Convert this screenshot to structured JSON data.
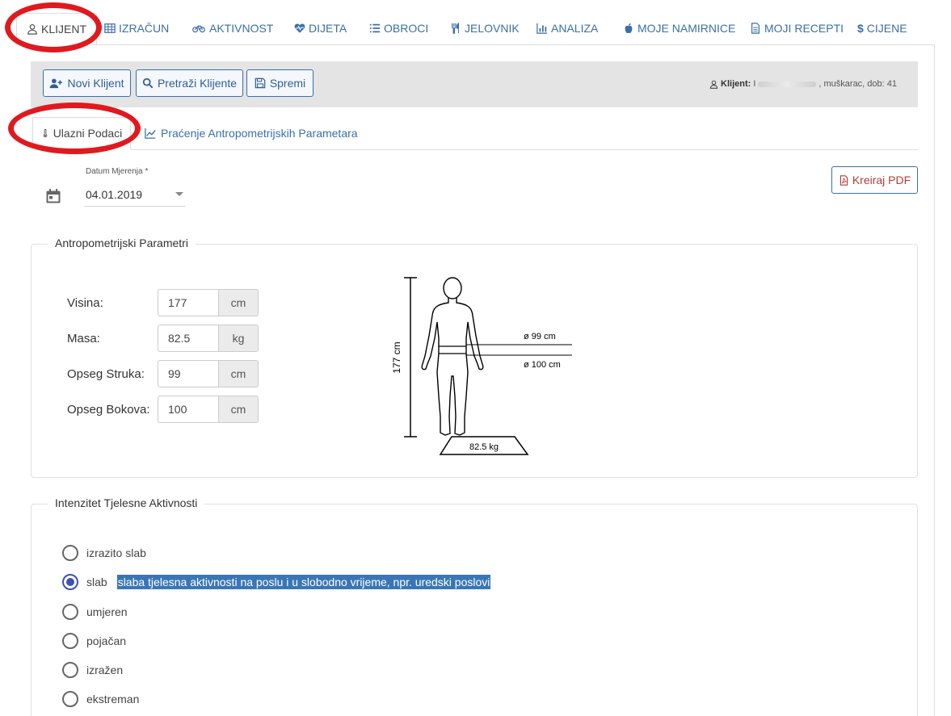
{
  "nav": {
    "tabs": [
      {
        "label": "KLIJENT",
        "icon": "user-icon",
        "active": true
      },
      {
        "label": "IZRAČUN",
        "icon": "table-icon"
      },
      {
        "label": "AKTIVNOST",
        "icon": "bicycle-icon"
      },
      {
        "label": "DIJETA",
        "icon": "heartbeat-icon"
      },
      {
        "label": "OBROCI",
        "icon": "list-icon"
      },
      {
        "label": "JELOVNIK",
        "icon": "cutlery-icon"
      },
      {
        "label": "ANALIZA",
        "icon": "bar-chart-icon"
      },
      {
        "label": "MOJE NAMIRNICE",
        "icon": "apple-icon"
      },
      {
        "label": "MOJI RECEPTI",
        "icon": "file-icon"
      },
      {
        "label": "CIJENE",
        "icon": "dollar-icon"
      }
    ]
  },
  "toolbar": {
    "new_client": "Novi Klijent",
    "search_clients": "Pretraži Klijente",
    "save": "Spremi",
    "client_label": "Klijent:",
    "client_name_prefix": "I",
    "client_details": ", muškarac, dob: 41"
  },
  "subtabs": {
    "input_data": "Ulazni Podaci",
    "tracking": "Praćenje Antropometrijskih Parametara"
  },
  "date": {
    "label": "Datum Mjerenja *",
    "value": "04.01.2019"
  },
  "pdf_button": "Kreiraj PDF",
  "anthropometric": {
    "legend": "Antropometrijski Parametri",
    "params": [
      {
        "label": "Visina:",
        "value": "177",
        "unit": "cm"
      },
      {
        "label": "Masa:",
        "value": "82.5",
        "unit": "kg"
      },
      {
        "label": "Opseg Struka:",
        "value": "99",
        "unit": "cm"
      },
      {
        "label": "Opseg Bokova:",
        "value": "100",
        "unit": "cm"
      }
    ],
    "figure": {
      "height_label": "177 cm",
      "waist_label": "ø 99 cm",
      "hip_label": "ø 100 cm",
      "weight_label": "82.5 kg"
    }
  },
  "activity": {
    "legend": "Intenzitet Tjelesne Aktivnosti",
    "options": [
      {
        "label": "izrazito slab",
        "checked": false
      },
      {
        "label": "slab",
        "checked": true,
        "description": "slaba tjelesna aktivnosti na poslu i u slobodno vrijeme, npr. uredski poslovi"
      },
      {
        "label": "umjeren",
        "checked": false
      },
      {
        "label": "pojačan",
        "checked": false
      },
      {
        "label": "izražen",
        "checked": false
      },
      {
        "label": "ekstreman",
        "checked": false
      }
    ]
  },
  "colors": {
    "accent": "#3a6fa8",
    "annotation": "#e0191e",
    "highlight": "#3a76b6"
  }
}
